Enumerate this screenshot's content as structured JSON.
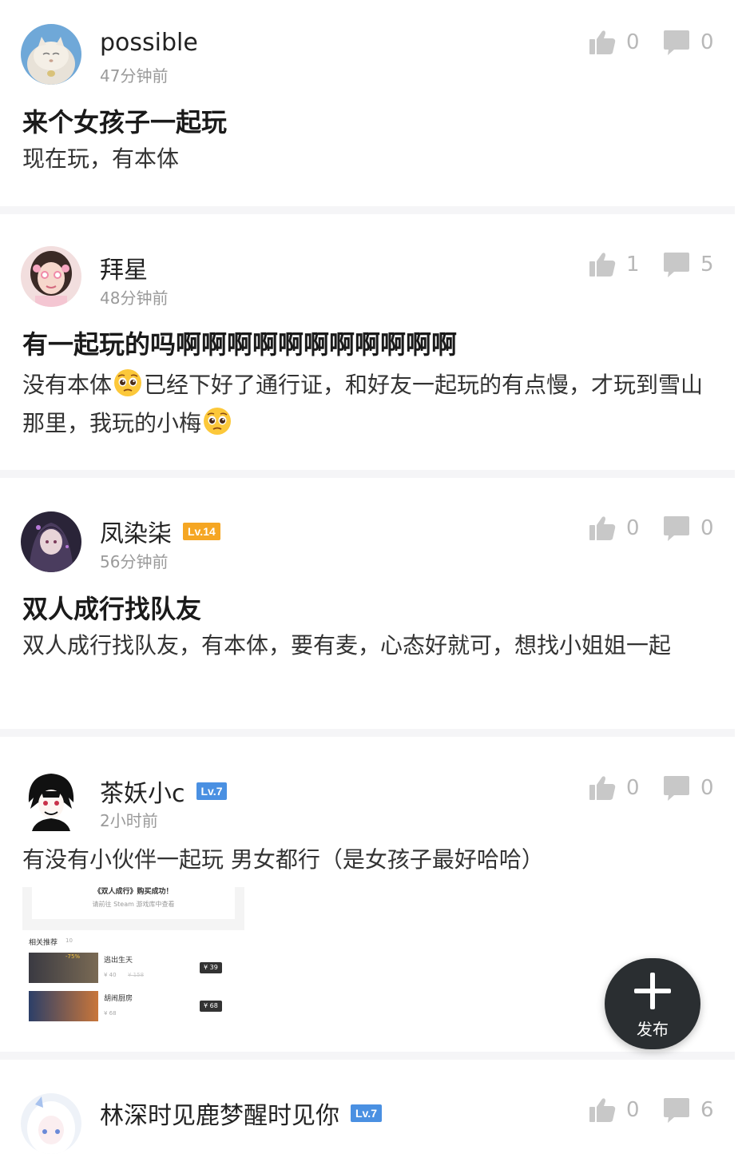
{
  "colors": {
    "lv_badge_orange": "#f5a623",
    "lv_badge_blue": "#4a90e2",
    "fab_bg": "#2a2e31",
    "icon_gray": "#c8c8c8"
  },
  "posts": [
    {
      "username": "possible",
      "time": "47分钟前",
      "likes": "0",
      "comments": "0",
      "title": "来个女孩子一起玩",
      "body": "现在玩，有本体"
    },
    {
      "username": "拜星",
      "time": "48分钟前",
      "likes": "1",
      "comments": "5",
      "title": "有一起玩的吗啊啊啊啊啊啊啊啊啊啊啊",
      "body_part1": "没有本体",
      "body_part2": "已经下好了通行证，和好友一起玩的有点慢，才玩到雪山那里，我玩的小梅"
    },
    {
      "username": "凤染柒",
      "level": "Lv.14",
      "time": "56分钟前",
      "likes": "0",
      "comments": "0",
      "title": "双人成行找队友",
      "body": "双人成行找队友，有本体，要有麦，心态好就可，想找小姐姐一起"
    },
    {
      "username": "茶妖小c",
      "level": "Lv.7",
      "time": "2小时前",
      "likes": "0",
      "comments": "0",
      "body": "有没有小伙伴一起玩 男女都行（是女孩子最好哈哈）",
      "image": {
        "line1": "《双人成行》购买成功！",
        "line2": "请前往 Steam 游戏库中查看",
        "section": "相关推荐",
        "section_count": "10",
        "games": [
          {
            "name": "逃出生天",
            "discount": "-75%",
            "price": "¥ 40",
            "old_price": "¥ 158",
            "button": "¥ 39"
          },
          {
            "name": "胡闹厨房",
            "price": "¥ 68",
            "button": "¥ 68"
          }
        ]
      }
    },
    {
      "username": "林深时见鹿梦醒时见你",
      "level": "Lv.7",
      "likes": "0",
      "comments": "6"
    }
  ],
  "fab": {
    "label": "发布"
  }
}
